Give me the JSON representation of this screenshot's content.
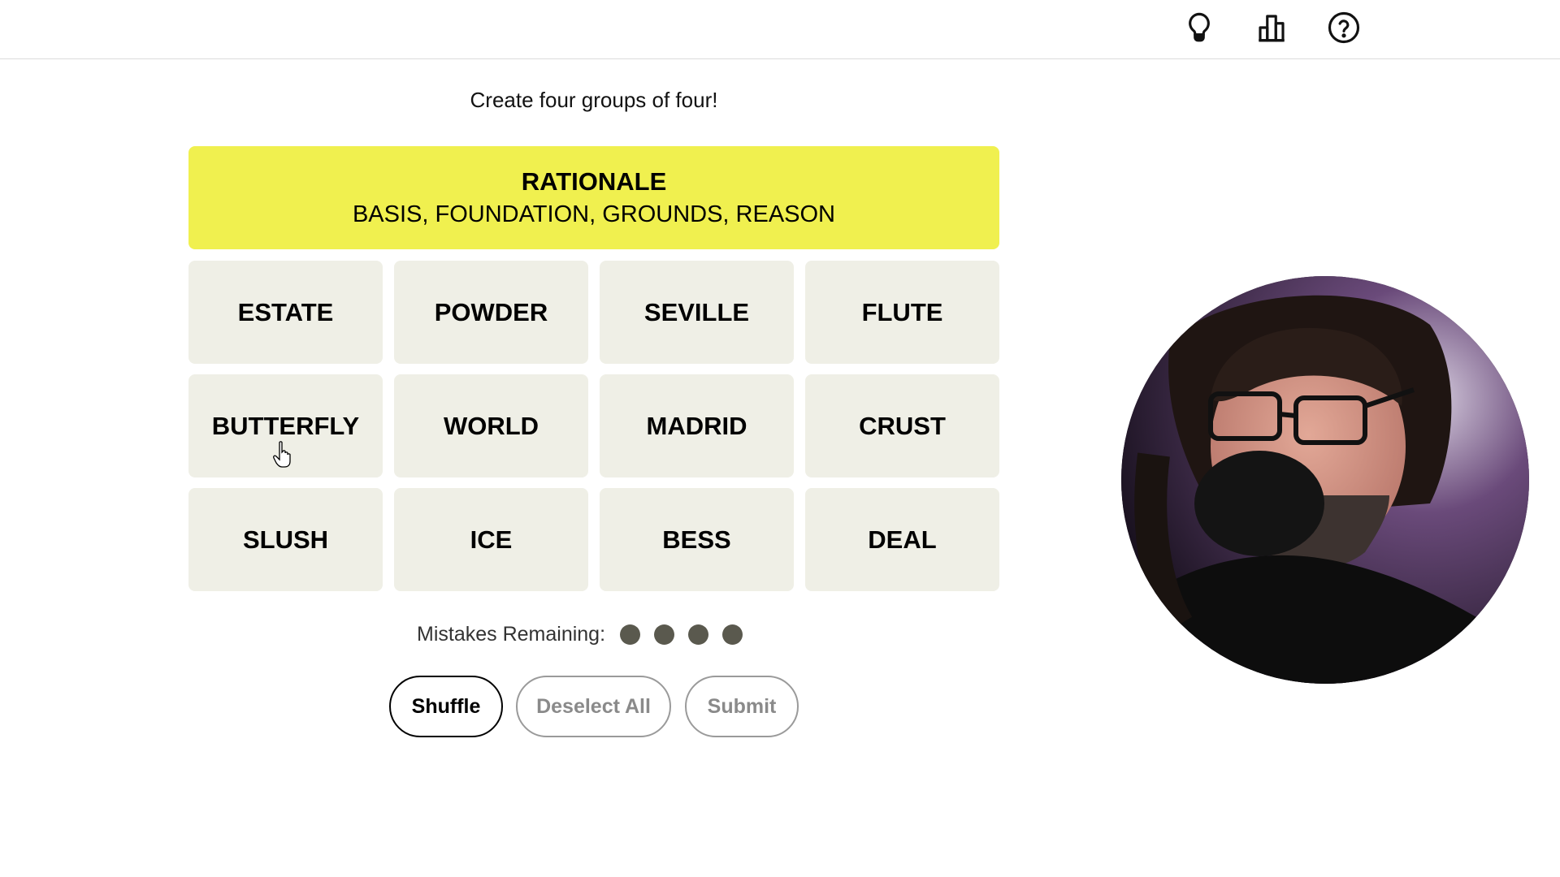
{
  "header": {
    "icons": [
      "lightbulb-icon",
      "stats-chart-icon",
      "help-icon"
    ]
  },
  "instructions": "Create four groups of four!",
  "solved_groups": [
    {
      "title": "RATIONALE",
      "members": "BASIS, FOUNDATION, GROUNDS, REASON",
      "color": "#f0f04f"
    }
  ],
  "tiles": [
    "ESTATE",
    "POWDER",
    "SEVILLE",
    "FLUTE",
    "BUTTERFLY",
    "WORLD",
    "MADRID",
    "CRUST",
    "SLUSH",
    "ICE",
    "BESS",
    "DEAL"
  ],
  "mistakes": {
    "label": "Mistakes Remaining:",
    "remaining": 4
  },
  "buttons": {
    "shuffle": "Shuffle",
    "deselect": "Deselect All",
    "submit": "Submit"
  },
  "colors": {
    "tile_bg": "#efefe6",
    "dot": "#5a594e",
    "yellow": "#f0f04f"
  }
}
